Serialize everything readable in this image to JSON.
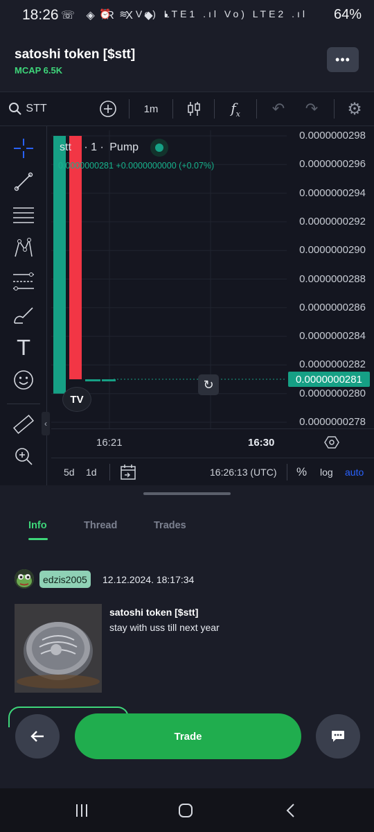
{
  "status_bar": {
    "time": "18:26",
    "left_icons": "☏ ◈ R X ◆ •",
    "right_icons": "⏰ ≋ Vo) LTE1 .ıl Vo) LTE2 .ıl",
    "battery": "64%"
  },
  "header": {
    "title": "satoshi token [$stt]",
    "mcap": "MCAP 6.5K",
    "menu_icon": "more-horizontal-icon"
  },
  "chart_toolbar": {
    "symbol": "STT",
    "interval": "1m"
  },
  "chart_legend": {
    "symbol": "stt",
    "interval": "· 1 ·",
    "source": "Pump",
    "ohlc_text": "0.0000000281  +0.0000000000 (+0.07%)"
  },
  "chart_data": {
    "type": "candlestick",
    "title": "",
    "xlabel": "",
    "ylabel": "",
    "ylim": [
      2.78e-08,
      2.98e-08
    ],
    "y_ticks": [
      "0.0000000298",
      "0.0000000296",
      "0.0000000294",
      "0.0000000292",
      "0.0000000290",
      "0.0000000288",
      "0.0000000286",
      "0.0000000284",
      "0.0000000282",
      "0.0000000280",
      "0.0000000278"
    ],
    "x_ticks": [
      "16:21",
      "16:30"
    ],
    "last_price": "0.0000000281",
    "colors": {
      "up": "#16a085",
      "down": "#f23645"
    },
    "candles": [
      {
        "open": 2.8e-08,
        "close": 2.98e-08,
        "high": 2.98e-08,
        "low": 2.8e-08,
        "direction": "up"
      },
      {
        "open": 2.98e-08,
        "close": 2.81e-08,
        "high": 2.98e-08,
        "low": 2.81e-08,
        "direction": "down"
      },
      {
        "open": 2.81e-08,
        "close": 2.81e-08,
        "high": 2.81e-08,
        "low": 2.81e-08,
        "direction": "up"
      },
      {
        "open": 2.81e-08,
        "close": 2.81e-08,
        "high": 2.81e-08,
        "low": 2.81e-08,
        "direction": "up"
      }
    ]
  },
  "chart_footer": {
    "range_5d": "5d",
    "range_1d": "1d",
    "clock": "16:26:13 (UTC)",
    "percent": "%",
    "log": "log",
    "auto": "auto"
  },
  "tabs": [
    {
      "label": "Info",
      "active": true
    },
    {
      "label": "Thread",
      "active": false
    },
    {
      "label": "Trades",
      "active": false
    }
  ],
  "post": {
    "username": "edzis2005",
    "date": "12.12.2024. 18:17:34",
    "title": "satoshi token [$stt]",
    "text": "stay with uss till next year"
  },
  "actions": {
    "trade_label": "Trade",
    "back_icon": "arrow-left-icon",
    "chat_icon": "chat-bubble-icon"
  },
  "colors": {
    "background": "#1b1d28",
    "chart_bg": "#141620",
    "accent_green": "#3ed67a",
    "trade_green": "#20ad4e",
    "blue_link": "#2962ff"
  }
}
